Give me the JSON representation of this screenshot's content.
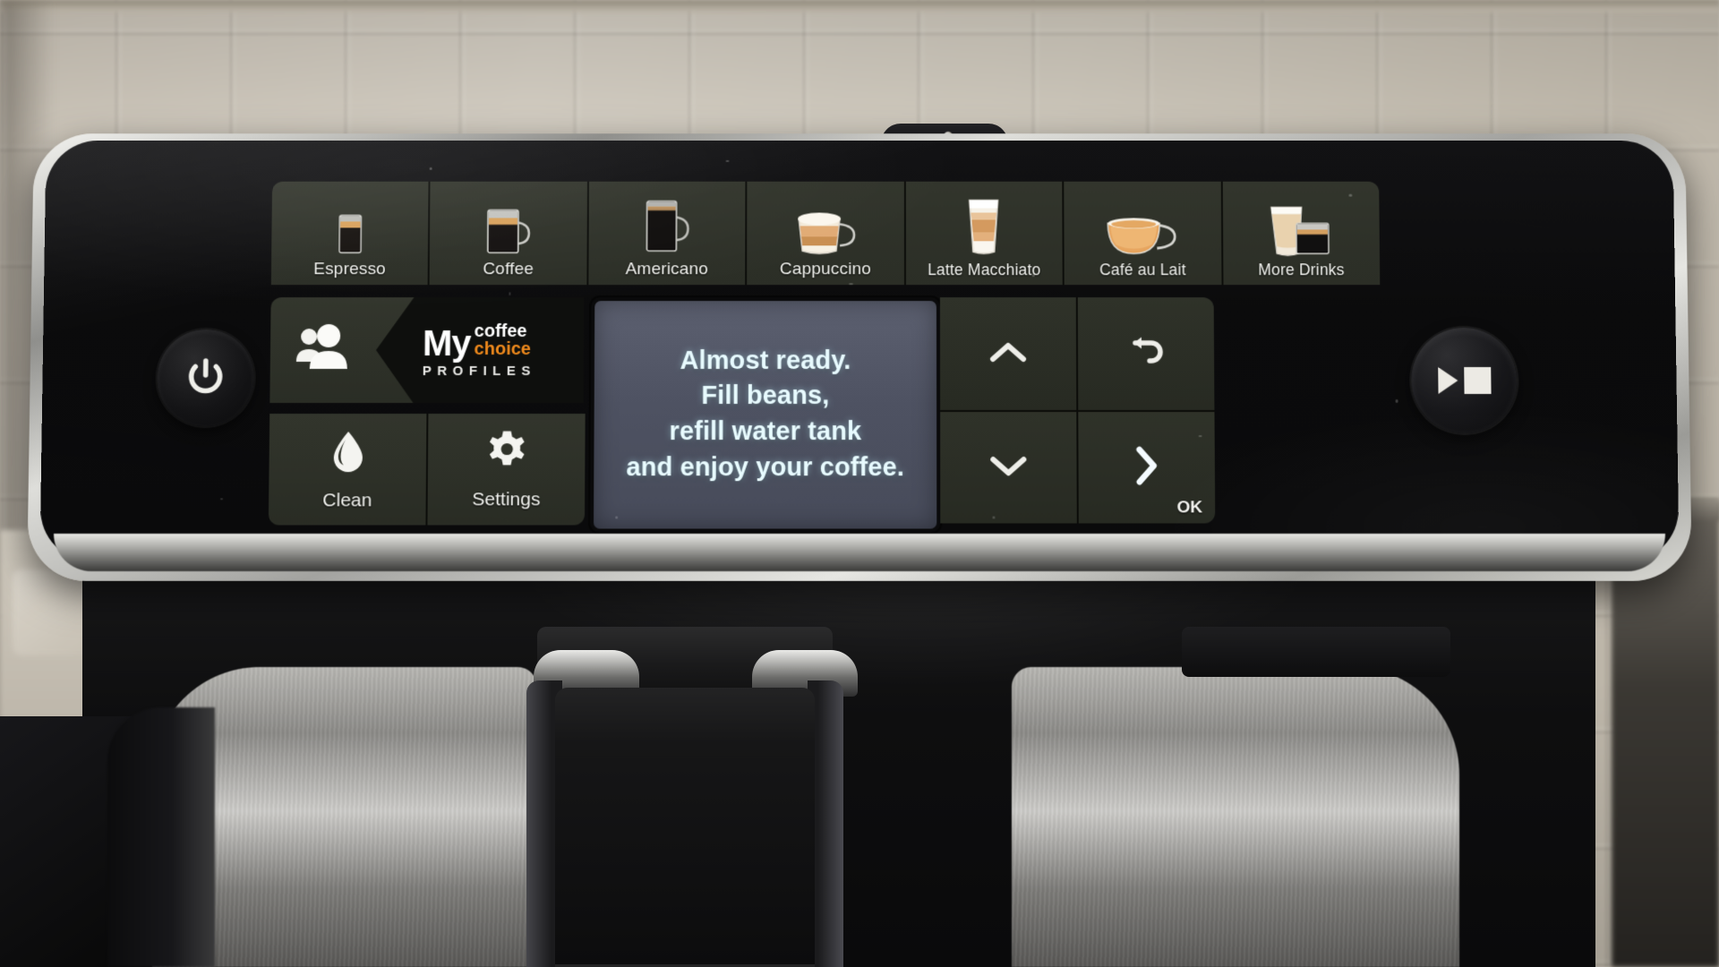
{
  "device": {
    "name": "Philips espresso machine control panel",
    "panel_color": "#0b0b0c",
    "button_color": "#32352c",
    "accent_orange": "#f08a1c",
    "screen_bg": "#4e5262",
    "screen_text_color": "#e8fbff"
  },
  "drinks": [
    {
      "label": "Espresso",
      "icon": "espresso-glass-icon"
    },
    {
      "label": "Coffee",
      "icon": "coffee-mug-icon"
    },
    {
      "label": "Americano",
      "icon": "americano-mug-icon"
    },
    {
      "label": "Cappuccino",
      "icon": "cappuccino-cup-icon"
    },
    {
      "label": "Latte Macchiato",
      "icon": "latte-macchiato-glass-icon"
    },
    {
      "label": "Café au Lait",
      "icon": "cafe-au-lait-bowl-icon"
    },
    {
      "label": "More Drinks",
      "icon": "more-drinks-glasses-icon"
    }
  ],
  "profiles": {
    "icon": "people-profiles-icon",
    "logo_my": "My",
    "logo_coffee": "coffee",
    "logo_choice": "choice",
    "logo_profiles": "PROFILES"
  },
  "utilities": [
    {
      "label": "Clean",
      "icon": "water-drop-icon"
    },
    {
      "label": "Settings",
      "icon": "gear-icon"
    }
  ],
  "display": {
    "lines": [
      "Almost ready.",
      "Fill beans,",
      "refill water tank",
      "and enjoy your coffee."
    ]
  },
  "navigation": {
    "up": {
      "icon": "chevron-up-icon",
      "label": ""
    },
    "back": {
      "icon": "back-arrow-icon",
      "label": ""
    },
    "down": {
      "icon": "chevron-down-icon",
      "label": ""
    },
    "ok": {
      "icon": "chevron-right-icon",
      "label": "OK"
    }
  },
  "power": {
    "icon": "power-icon"
  },
  "start_stop": {
    "icon": "play-stop-icon"
  }
}
